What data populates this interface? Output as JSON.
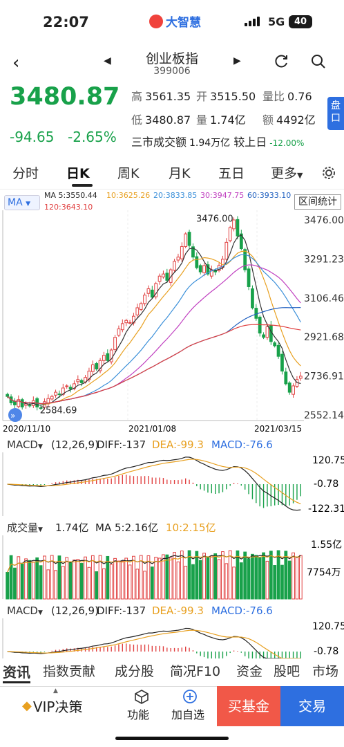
{
  "status": {
    "time": "22:07",
    "app": "大智慧",
    "network": "5G",
    "battery": "40"
  },
  "nav": {
    "title": "创业板指",
    "code": "399006"
  },
  "quote": {
    "price": "3480.87",
    "change": "-94.65",
    "change_pct": "-2.65%",
    "high_label": "高",
    "high": "3561.35",
    "open_label": "开",
    "open": "3515.50",
    "ratio_label": "量比",
    "ratio": "0.76",
    "low_label": "低",
    "low": "3480.87",
    "vol_label": "量",
    "vol": "1.74亿",
    "amount_label": "额",
    "amount": "4492亿",
    "market_label": "三市成交额",
    "market_amount": "1.94万亿",
    "vs_label": "较上日",
    "vs_pct": "-12.00%",
    "pan_label": "盘口"
  },
  "tabs": [
    {
      "label": "分时",
      "active": false
    },
    {
      "label": "日K",
      "active": true
    },
    {
      "label": "周K",
      "active": false
    },
    {
      "label": "月K",
      "active": false
    },
    {
      "label": "五日",
      "active": false
    },
    {
      "label": "更多",
      "active": false
    }
  ],
  "ma_bar": {
    "selector": "MA",
    "items": [
      {
        "text": "MA 5:3550.44",
        "color": "#333333"
      },
      {
        "text": "10:3625.26",
        "color": "#e8a020"
      },
      {
        "text": "20:3833.85",
        "color": "#3a8fd9"
      },
      {
        "text": "30:3947.75",
        "color": "#c040c0"
      },
      {
        "text": "60:3933.10",
        "color": "#2060c0"
      },
      {
        "text": "120:3643.10",
        "color": "#e04040"
      }
    ],
    "range_stat": "区间统计"
  },
  "chart_data": [
    {
      "type": "candlestick",
      "y_ticks": [
        "3476.00",
        "3291.23",
        "3106.46",
        "2921.68",
        "2736.91",
        "2552.14"
      ],
      "ylim": [
        2552.14,
        3476.0
      ],
      "x_ticks": [
        "2020/11/10",
        "2021/01/08",
        "2021/03/15"
      ],
      "annotations": [
        {
          "text": "3476.00",
          "type": "max"
        },
        {
          "text": "2584.69",
          "type": "min"
        }
      ],
      "closes": [
        2640,
        2610,
        2600,
        2625,
        2590,
        2605,
        2595,
        2620,
        2590,
        2585,
        2615,
        2630,
        2640,
        2660,
        2650,
        2680,
        2690,
        2675,
        2700,
        2720,
        2705,
        2730,
        2760,
        2790,
        2770,
        2810,
        2835,
        2810,
        2860,
        2920,
        2960,
        2985,
        3000,
        2990,
        3020,
        3060,
        3080,
        3120,
        3150,
        3110,
        3175,
        3210,
        3220,
        3190,
        3240,
        3280,
        3300,
        3350,
        3410,
        3355,
        3300,
        3250,
        3230,
        3260,
        3220,
        3240,
        3230,
        3260,
        3290,
        3370,
        3440,
        3476,
        3400,
        3340,
        3240,
        3160,
        3060,
        3010,
        2940,
        2920,
        2970,
        2900,
        2880,
        2830,
        2760,
        2700,
        2660,
        2690,
        2720,
        2736
      ]
    },
    {
      "type": "bar",
      "name": "MACD",
      "params": "(12,26,9)",
      "diff": "DIFF:-137",
      "dea": "DEA:-99.3",
      "macd": "MACD:-76.6",
      "y_ticks": [
        "120.75",
        "-0.78",
        "-122.31"
      ]
    },
    {
      "type": "bar",
      "name": "成交量",
      "vol": "1.74亿",
      "ma5": "MA 5:2.16亿",
      "ma10": "10:2.15亿",
      "y_ticks": [
        "1.55亿",
        "7754万"
      ]
    },
    {
      "type": "bar",
      "name": "MACD",
      "params": "(12,26,9)",
      "diff": "DIFF:-137",
      "dea": "DEA:-99.3",
      "macd": "MACD:-76.6",
      "y_ticks": [
        "120.75",
        "-0.78"
      ]
    }
  ],
  "subtabs": [
    "资讯",
    "指数贡献",
    "成分股",
    "简况F10",
    "资金",
    "股吧",
    "市场"
  ],
  "bottom": {
    "vip": "VIP决策",
    "func": "功能",
    "add": "加自选",
    "buy": "买基金",
    "trade": "交易"
  },
  "colors": {
    "up": "#e04040",
    "down": "#18a14a",
    "accent": "#2e6fe0"
  }
}
